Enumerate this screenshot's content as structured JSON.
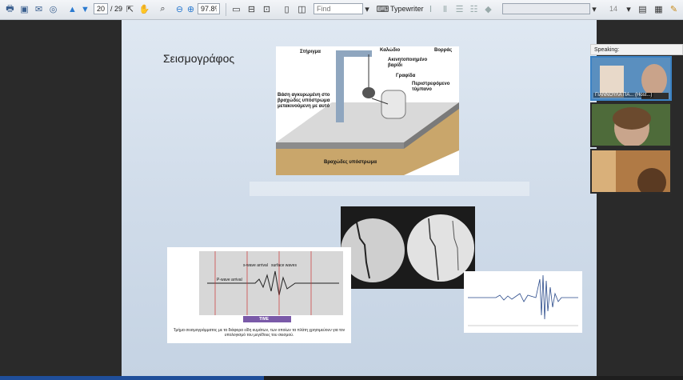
{
  "toolbar": {
    "page_current": "20",
    "page_total": "/ 29",
    "zoom": "97.8%",
    "find_placeholder": "Find",
    "typewriter_label": "Typewriter",
    "font_size": "14"
  },
  "slide": {
    "title": "Σεισμογράφος",
    "diagram_labels": {
      "support": "Στήριγμα",
      "wire": "Καλώδιο",
      "north": "Βορράς",
      "mass": "Ακινητοποιημένο βαρίδι",
      "pen": "Γραφίδα",
      "drum": "Περιστρεφόμενο τύμπανο",
      "base": "Βάση αγκυρωμένη στο βραχώδες υπόστρωμα μετακινούμενη με αυτό",
      "bedrock": "Βραχώδες υπόστρωμα"
    },
    "seismogram_labels": {
      "s_wave": "s-wave arrival",
      "surface_wave": "surface waves",
      "p_wave": "P-wave arrival",
      "time_label": "TIME",
      "caption": "Τμήμα σεισμογράμματος με τα διάφορα είδη κυμάτων, των οποίων τα πλάτη χρησιμεύουν για τον υπολογισμό του μεγέθους του σεισμού."
    }
  },
  "participants": {
    "speaking_label": "Speaking:",
    "tiles": [
      {
        "name": "ΓΙΑΝΝΟΥΛΑ ΠΑ... (Host...)"
      },
      {
        "name": ""
      },
      {
        "name": ""
      }
    ]
  }
}
